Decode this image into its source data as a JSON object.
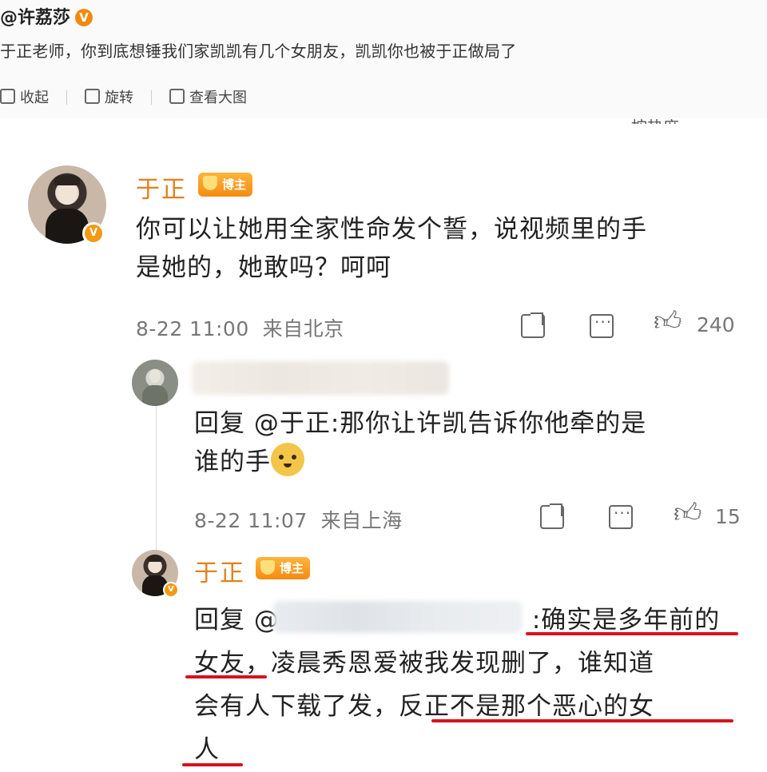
{
  "post": {
    "author": "@许荔莎",
    "verified": "V",
    "text": "于正老师，你到底想锤我们家凯凯有几个女朋友，凯凯你也被于正做局了",
    "tools": [
      "收起",
      "旋转",
      "查看大图"
    ]
  },
  "sort_label": "按热度",
  "comments": [
    {
      "name": "于正",
      "badge": "博主",
      "text_line1": "你可以让她用全家性命发个誓，说视频里的手",
      "text_line2": "是她的，她敢吗？呵呵",
      "time": "8-22 11:00",
      "location": "来自北京",
      "likes": "240"
    }
  ],
  "replies": [
    {
      "text_line1": "回复 @于正:那你让许凯告诉你他牵的是",
      "text_line2": "谁的手",
      "time": "8-22 11:07",
      "location": "来自上海",
      "likes": "15"
    },
    {
      "name": "于正",
      "badge": "博主",
      "prefix": "回复 @",
      "line1_tail": ":确实是多年前的",
      "line2": "女友，凌晨秀恩爱被我发现删了，谁知道",
      "line3": "会有人下载了发，反正不是那个恶心的女",
      "line4": "人"
    }
  ],
  "colors": {
    "name": "#e2801f",
    "badge": "#f58b12",
    "underline": "#d6121e",
    "meta": "#777777"
  },
  "icons": [
    "rotate-icon",
    "collapse-icon",
    "view-large-icon",
    "share-icon",
    "comment-icon",
    "like-icon",
    "verified-icon",
    "doge-emoji-icon"
  ]
}
